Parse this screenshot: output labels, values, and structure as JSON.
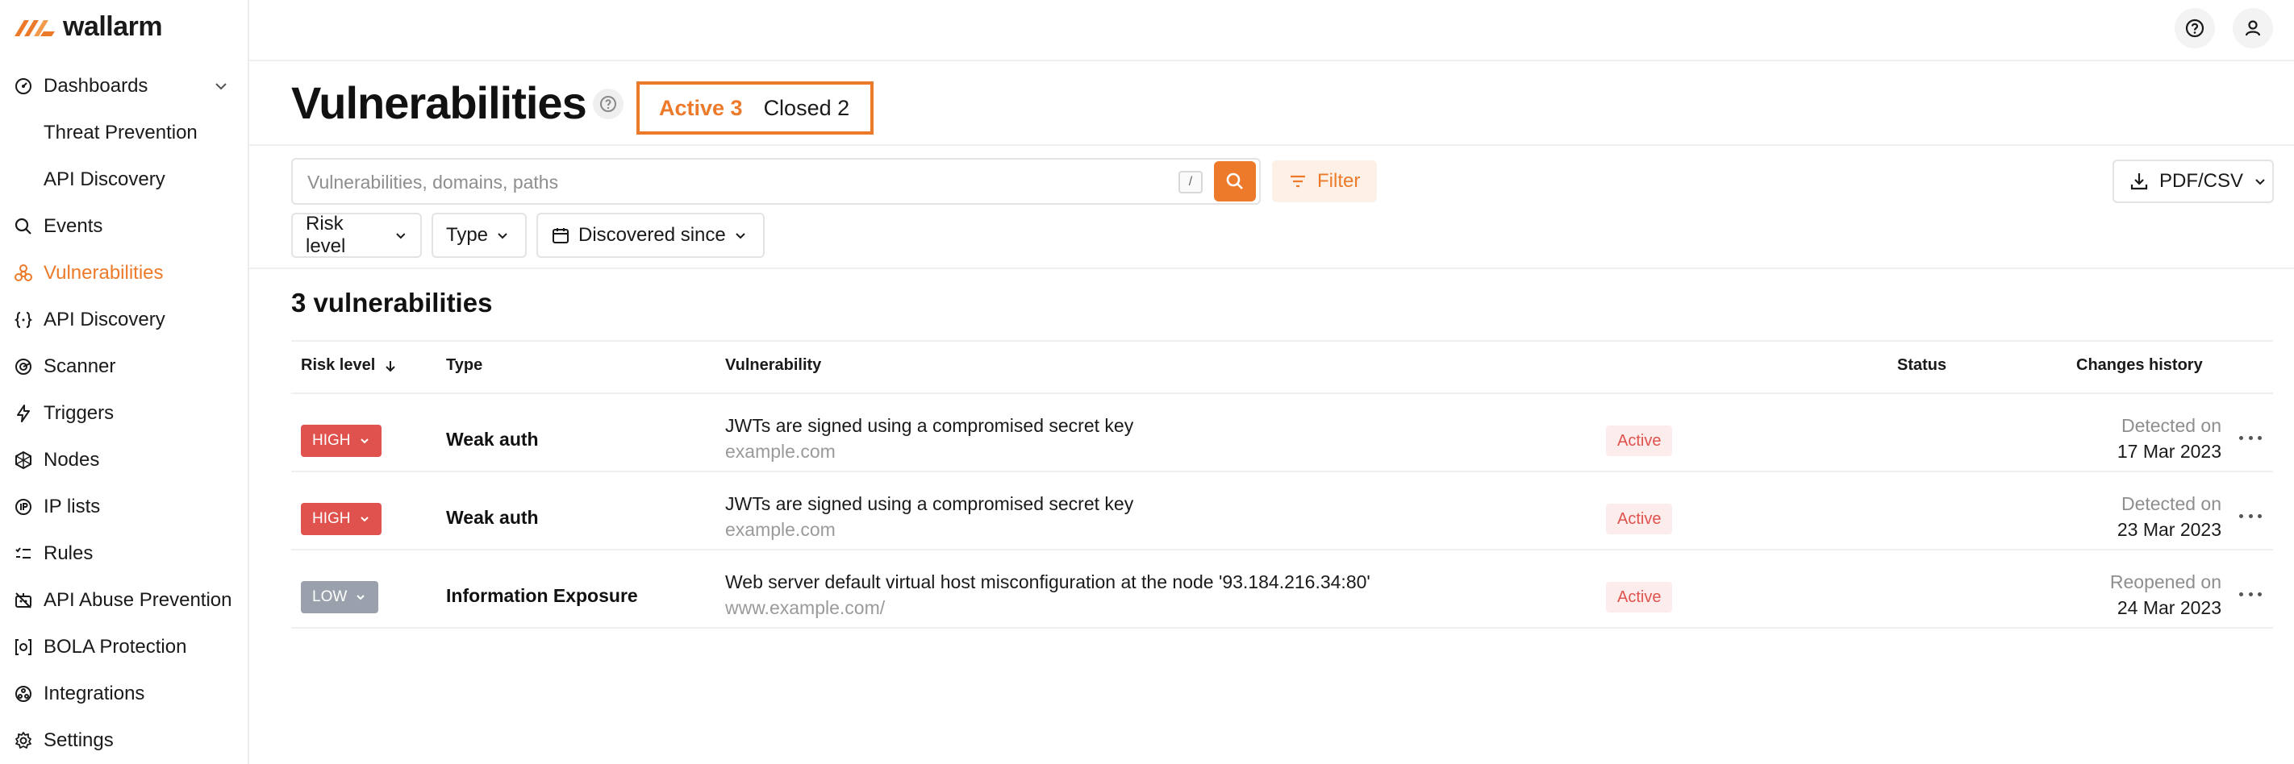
{
  "brand": {
    "name": "wallarm",
    "accent": "#ec7a2a"
  },
  "sidebar": {
    "items": [
      {
        "label": "Dashboards",
        "icon": "dashboard-icon",
        "expandable": true
      },
      {
        "label": "Threat Prevention",
        "sub": true
      },
      {
        "label": "API Discovery",
        "sub": true
      },
      {
        "label": "Events",
        "icon": "search-icon"
      },
      {
        "label": "Vulnerabilities",
        "icon": "biohazard-icon",
        "active": true
      },
      {
        "label": "API Discovery",
        "icon": "braces-icon"
      },
      {
        "label": "Scanner",
        "icon": "radar-icon"
      },
      {
        "label": "Triggers",
        "icon": "bolt-icon"
      },
      {
        "label": "Nodes",
        "icon": "nodes-icon"
      },
      {
        "label": "IP lists",
        "icon": "ip-icon"
      },
      {
        "label": "Rules",
        "icon": "rules-icon"
      },
      {
        "label": "API Abuse Prevention",
        "icon": "robot-icon"
      },
      {
        "label": "BOLA Protection",
        "icon": "bola-icon"
      },
      {
        "label": "Integrations",
        "icon": "integrations-icon"
      },
      {
        "label": "Settings",
        "icon": "gear-icon"
      }
    ]
  },
  "topbar": {
    "help_icon": "help-icon",
    "user_icon": "user-icon"
  },
  "header": {
    "title": "Vulnerabilities",
    "tabs": {
      "active": "Active 3",
      "closed": "Closed 2"
    }
  },
  "search": {
    "placeholder": "Vulnerabilities, domains, paths",
    "shortcut": "/"
  },
  "filter_label": "Filter",
  "export_label": "PDF/CSV",
  "dropdowns": {
    "risk": "Risk level",
    "type": "Type",
    "discovered": "Discovered since"
  },
  "count_title": "3 vulnerabilities",
  "table": {
    "headers": {
      "risk": "Risk level",
      "type": "Type",
      "vulnerability": "Vulnerability",
      "status": "Status",
      "history": "Changes history"
    },
    "rows": [
      {
        "risk": "HIGH",
        "type": "Weak auth",
        "title": "JWTs are signed using a compromised secret key",
        "domain": "example.com",
        "status": "Active",
        "history_label": "Detected on",
        "history_date": "17 Mar 2023"
      },
      {
        "risk": "HIGH",
        "type": "Weak auth",
        "title": "JWTs are signed using a compromised secret key",
        "domain": "example.com",
        "status": "Active",
        "history_label": "Detected on",
        "history_date": "23 Mar 2023"
      },
      {
        "risk": "LOW",
        "type": "Information Exposure",
        "title": "Web server default virtual host misconfiguration at the node '93.184.216.34:80'",
        "domain": "www.example.com/",
        "status": "Active",
        "history_label": "Reopened on",
        "history_date": "24 Mar 2023"
      }
    ]
  },
  "colors": {
    "accent": "#ec7a2a",
    "high": "#e0524d",
    "low": "#9aa1ad",
    "status_active_bg": "#fdecec"
  }
}
